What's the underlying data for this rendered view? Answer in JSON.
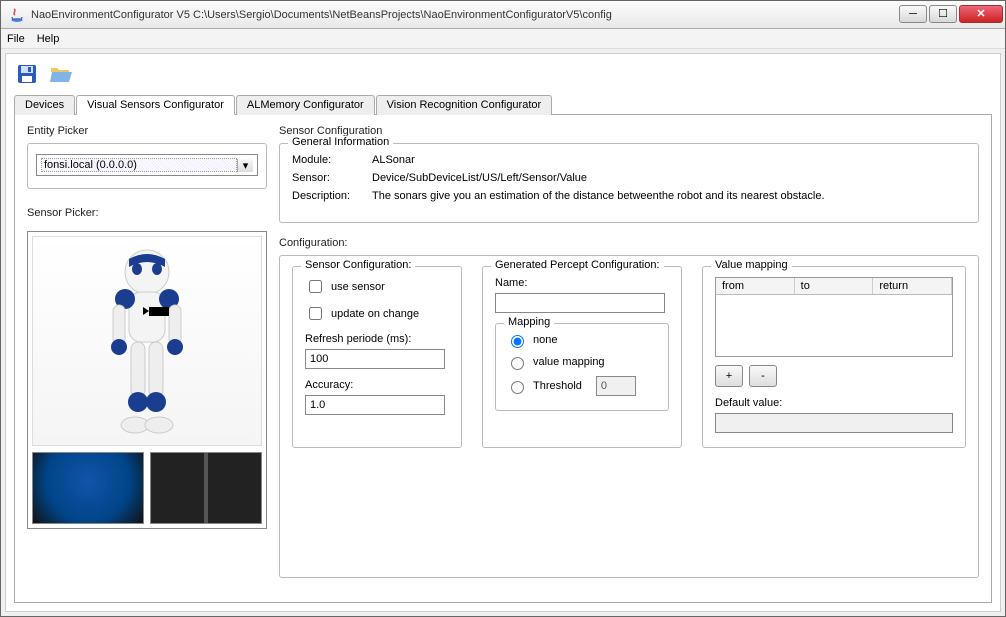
{
  "window": {
    "title": "NaoEnvironmentConfigurator V5 C:\\Users\\Sergio\\Documents\\NetBeansProjects\\NaoEnvironmentConfiguratorV5\\config"
  },
  "menu": {
    "file": "File",
    "help": "Help"
  },
  "tabs": [
    "Devices",
    "Visual Sensors Configurator",
    "ALMemory Configurator",
    "Vision Recognition Configurator"
  ],
  "activeTab": 1,
  "entityPicker": {
    "label": "Entity Picker",
    "value": "fonsi.local (0.0.0.0)"
  },
  "sensorPicker": {
    "label": "Sensor Picker:"
  },
  "sensorConfigLabel": "Sensor Configuration",
  "generalInfo": {
    "legend": "General Information",
    "moduleLabel": "Module:",
    "module": "ALSonar",
    "sensorLabel": "Sensor:",
    "sensor": "Device/SubDeviceList/US/Left/Sensor/Value",
    "descLabel": "Description:",
    "desc": "The sonars give you an estimation of the distance betweenthe robot and its nearest obstacle."
  },
  "configLabel": "Configuration:",
  "sensorCfg": {
    "legend": "Sensor Configuration:",
    "useSensor": "use sensor",
    "updateOnChange": "update on change",
    "refreshLabel": "Refresh periode (ms):",
    "refresh": "100",
    "accuracyLabel": "Accuracy:",
    "accuracy": "1.0"
  },
  "perceptCfg": {
    "legend": "Generated Percept Configuration:",
    "nameLabel": "Name:",
    "name": "",
    "mappingLegend": "Mapping",
    "none": "none",
    "valueMapping": "value mapping",
    "threshold": "Threshold",
    "thresholdVal": "0"
  },
  "valueMapping": {
    "legend": "Value mapping",
    "cols": {
      "from": "from",
      "to": "to",
      "return": "return"
    },
    "add": "+",
    "remove": "-",
    "defaultLabel": "Default value:",
    "defaultVal": ""
  }
}
